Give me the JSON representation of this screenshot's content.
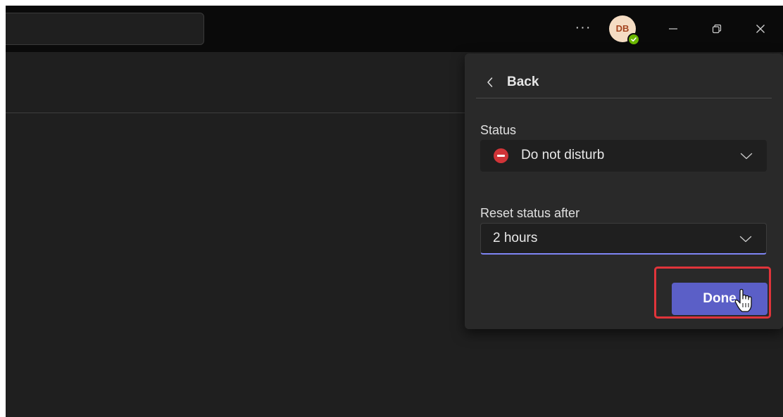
{
  "titlebar": {
    "more_label": "···",
    "avatar_initials": "DB",
    "presence_status": "available",
    "icons": [
      "more-icon",
      "minimize-icon",
      "restore-icon",
      "close-icon"
    ]
  },
  "panel": {
    "back_label": "Back",
    "status_label": "Status",
    "status_value": "Do not disturb",
    "status_icon": "do-not-disturb-icon",
    "status_color": "#d13438",
    "reset_label": "Reset status after",
    "reset_value": "2 hours",
    "done_label": "Done"
  },
  "colors": {
    "accent": "#5b5fc7",
    "highlight": "#e0343a",
    "presence_available": "#6bb700"
  }
}
